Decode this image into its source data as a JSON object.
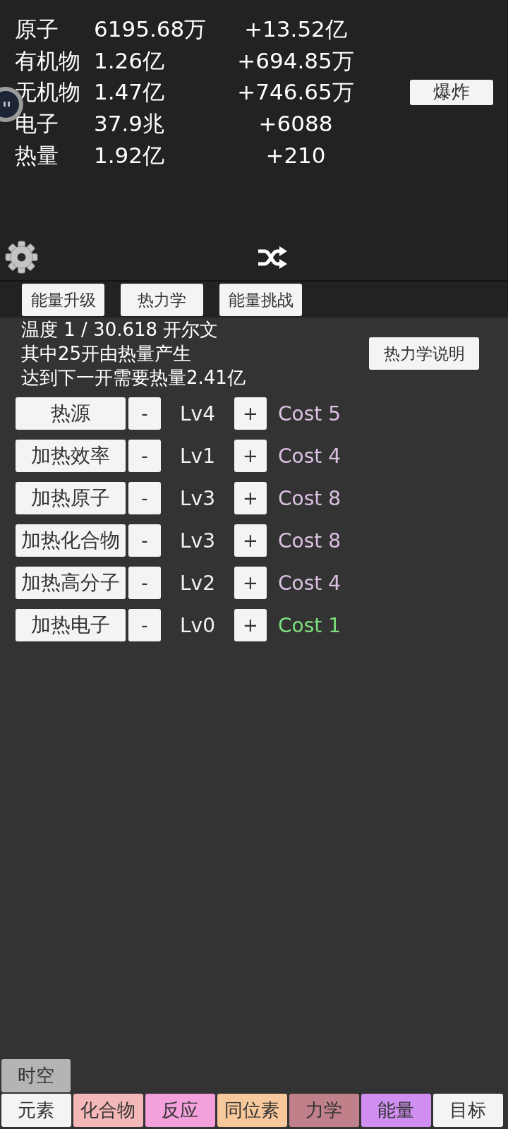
{
  "stats": [
    {
      "name": "原子",
      "value": "6195.68万",
      "delta": "+13.52亿"
    },
    {
      "name": "有机物",
      "value": "1.26亿",
      "delta": "+694.85万"
    },
    {
      "name": "无机物",
      "value": "1.47亿",
      "delta": "+746.65万"
    },
    {
      "name": "电子",
      "value": "37.9兆",
      "delta": "+6088"
    },
    {
      "name": "热量",
      "value": "1.92亿",
      "delta": "+210"
    }
  ],
  "explode_button": "爆炸",
  "subtabs": [
    "能量升级",
    "热力学",
    "能量挑战"
  ],
  "info": {
    "lines": [
      "温度 1 / 30.618 开尔文",
      "其中25开由热量产生",
      "达到下一开需要热量2.41亿"
    ],
    "help_button": "热力学说明"
  },
  "upgrades": [
    {
      "name": "热源",
      "minus": "-",
      "lv": "Lv4",
      "plus": "+",
      "cost": "Cost 5",
      "affordable": false
    },
    {
      "name": "加热效率",
      "minus": "-",
      "lv": "Lv1",
      "plus": "+",
      "cost": "Cost 4",
      "affordable": false
    },
    {
      "name": "加热原子",
      "minus": "-",
      "lv": "Lv3",
      "plus": "+",
      "cost": "Cost 8",
      "affordable": false
    },
    {
      "name": "加热化合物",
      "minus": "-",
      "lv": "Lv3",
      "plus": "+",
      "cost": "Cost 8",
      "affordable": false
    },
    {
      "name": "加热高分子",
      "minus": "-",
      "lv": "Lv2",
      "plus": "+",
      "cost": "Cost 4",
      "affordable": false
    },
    {
      "name": "加热电子",
      "minus": "-",
      "lv": "Lv0",
      "plus": "+",
      "cost": "Cost 1",
      "affordable": true
    }
  ],
  "spacetime_button": "时空",
  "nav": [
    {
      "label": "元素",
      "color": "#f4f4f4"
    },
    {
      "label": "化合物",
      "color": "#f4b8b8"
    },
    {
      "label": "反应",
      "color": "#f4a0dc"
    },
    {
      "label": "同位素",
      "color": "#f6c89c"
    },
    {
      "label": "力学",
      "color": "#c0808a"
    },
    {
      "label": "能量",
      "color": "#d08ef0"
    },
    {
      "label": "目标",
      "color": "#f4f4f4"
    }
  ]
}
